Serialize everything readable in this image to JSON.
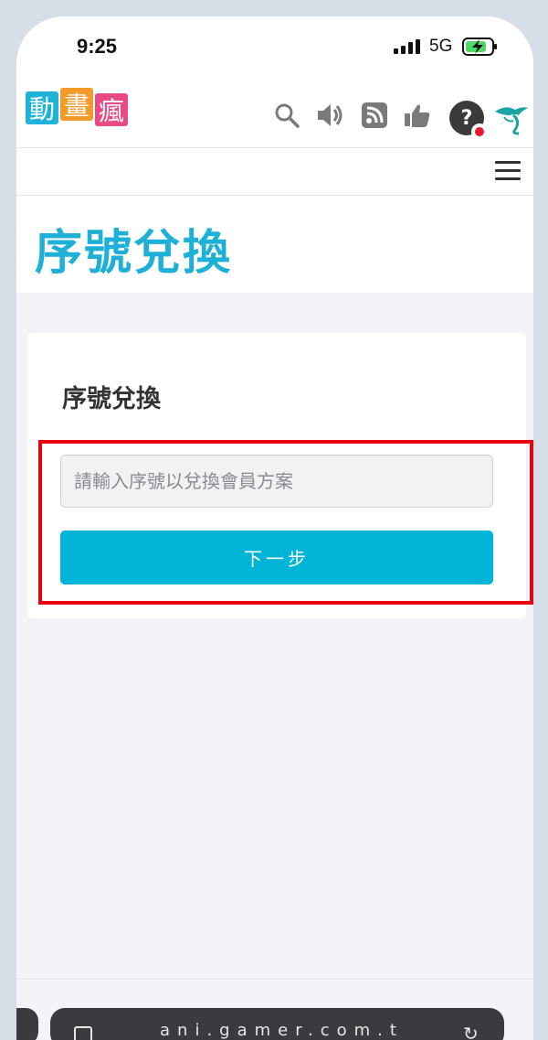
{
  "status_bar": {
    "time": "9:25",
    "network": "5G",
    "battery_color": "#4cd964"
  },
  "header": {
    "logo_chars": [
      "動",
      "畫",
      "瘋"
    ],
    "logo_colors": [
      "#20b3d9",
      "#f29b2a",
      "#e94a86"
    ],
    "icons": [
      "search-icon",
      "volume-icon",
      "rss-icon",
      "thumbs-up-icon",
      "avatar",
      "dragon-logo-icon"
    ],
    "avatar_glyph": "?"
  },
  "page": {
    "title": "序號兌換",
    "accent_color": "#1fb0d8"
  },
  "card": {
    "title": "序號兌換",
    "input_placeholder": "請輸入序號以兌換會員方案",
    "next_button_label": "下一步",
    "button_color": "#00b4d8",
    "highlight_color": "#e60012"
  },
  "browser_bar": {
    "address_text": "ani.gamer.com.tw",
    "reload_glyph": "↻"
  }
}
